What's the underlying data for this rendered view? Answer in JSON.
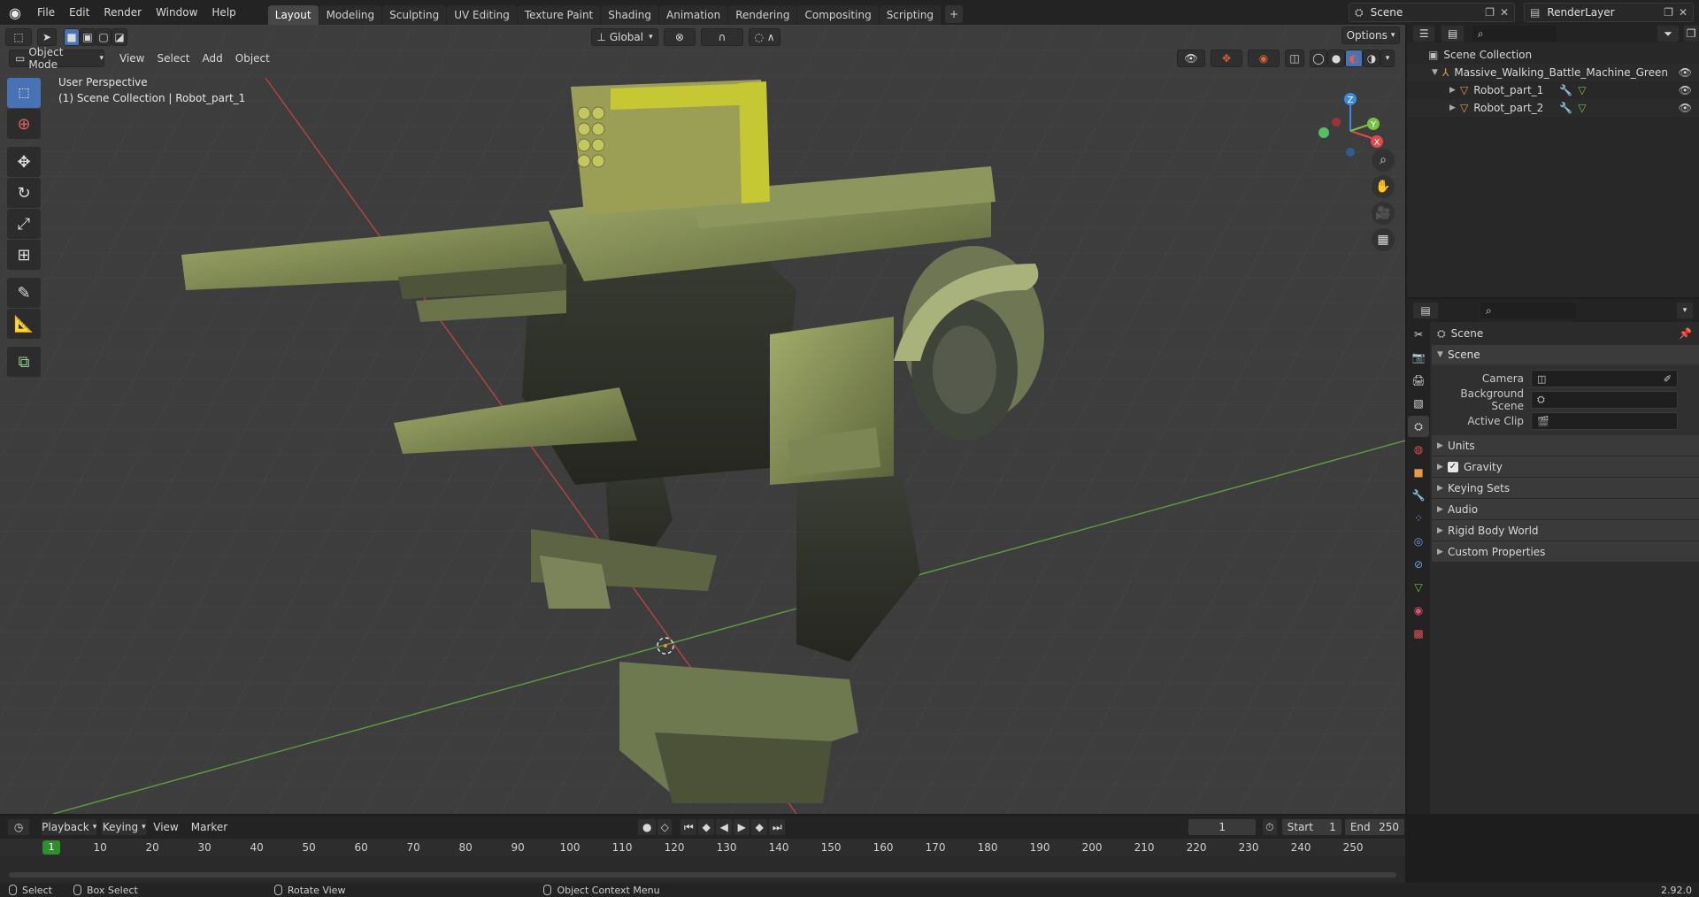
{
  "app": {
    "menus": [
      "File",
      "Edit",
      "Render",
      "Window",
      "Help"
    ],
    "workspace_tabs": [
      "Layout",
      "Modeling",
      "Sculpting",
      "UV Editing",
      "Texture Paint",
      "Shading",
      "Animation",
      "Rendering",
      "Compositing",
      "Scripting"
    ],
    "active_tab": "Layout",
    "scene_name": "Scene",
    "render_layer": "RenderLayer"
  },
  "viewport": {
    "mode": "Object Mode",
    "menus": [
      "View",
      "Select",
      "Add",
      "Object"
    ],
    "transform_orientation": "Global",
    "options_label": "Options",
    "perspective_label": "User Perspective",
    "collection_label": "(1) Scene Collection | Robot_part_1",
    "gizmo_axes": {
      "x": "X",
      "y": "Y",
      "z": "Z"
    }
  },
  "outliner": {
    "root": "Scene Collection",
    "collection": "Massive_Walking_Battle_Machine_Green",
    "items": [
      "Robot_part_1",
      "Robot_part_2"
    ]
  },
  "properties": {
    "context_title": "Scene",
    "panel_title": "Scene",
    "fields": [
      {
        "label": "Camera",
        "value": ""
      },
      {
        "label": "Background Scene",
        "value": ""
      },
      {
        "label": "Active Clip",
        "value": ""
      }
    ],
    "sections": [
      "Units",
      "Gravity",
      "Keying Sets",
      "Audio",
      "Rigid Body World",
      "Custom Properties"
    ],
    "gravity_checked": true
  },
  "timeline": {
    "menus": [
      "Playback",
      "Keying",
      "View",
      "Marker"
    ],
    "current_frame": "1",
    "start_label": "Start",
    "start": "1",
    "end_label": "End",
    "end": "250",
    "ticks": [
      "1",
      "10",
      "20",
      "30",
      "40",
      "50",
      "60",
      "70",
      "80",
      "90",
      "100",
      "110",
      "120",
      "130",
      "140",
      "150",
      "160",
      "170",
      "180",
      "190",
      "200",
      "210",
      "220",
      "230",
      "240",
      "250"
    ]
  },
  "statusbar": {
    "select": "Select",
    "box_select": "Box Select",
    "rotate_view": "Rotate View",
    "context_menu": "Object Context Menu",
    "version": "2.92.0"
  },
  "colors": {
    "accent": "#4772b3",
    "x_axis": "#e04a4a",
    "y_axis": "#7bc043",
    "z_axis": "#3d8be0",
    "robot_green": "#8a9a52",
    "robot_yellow": "#c5c832"
  }
}
